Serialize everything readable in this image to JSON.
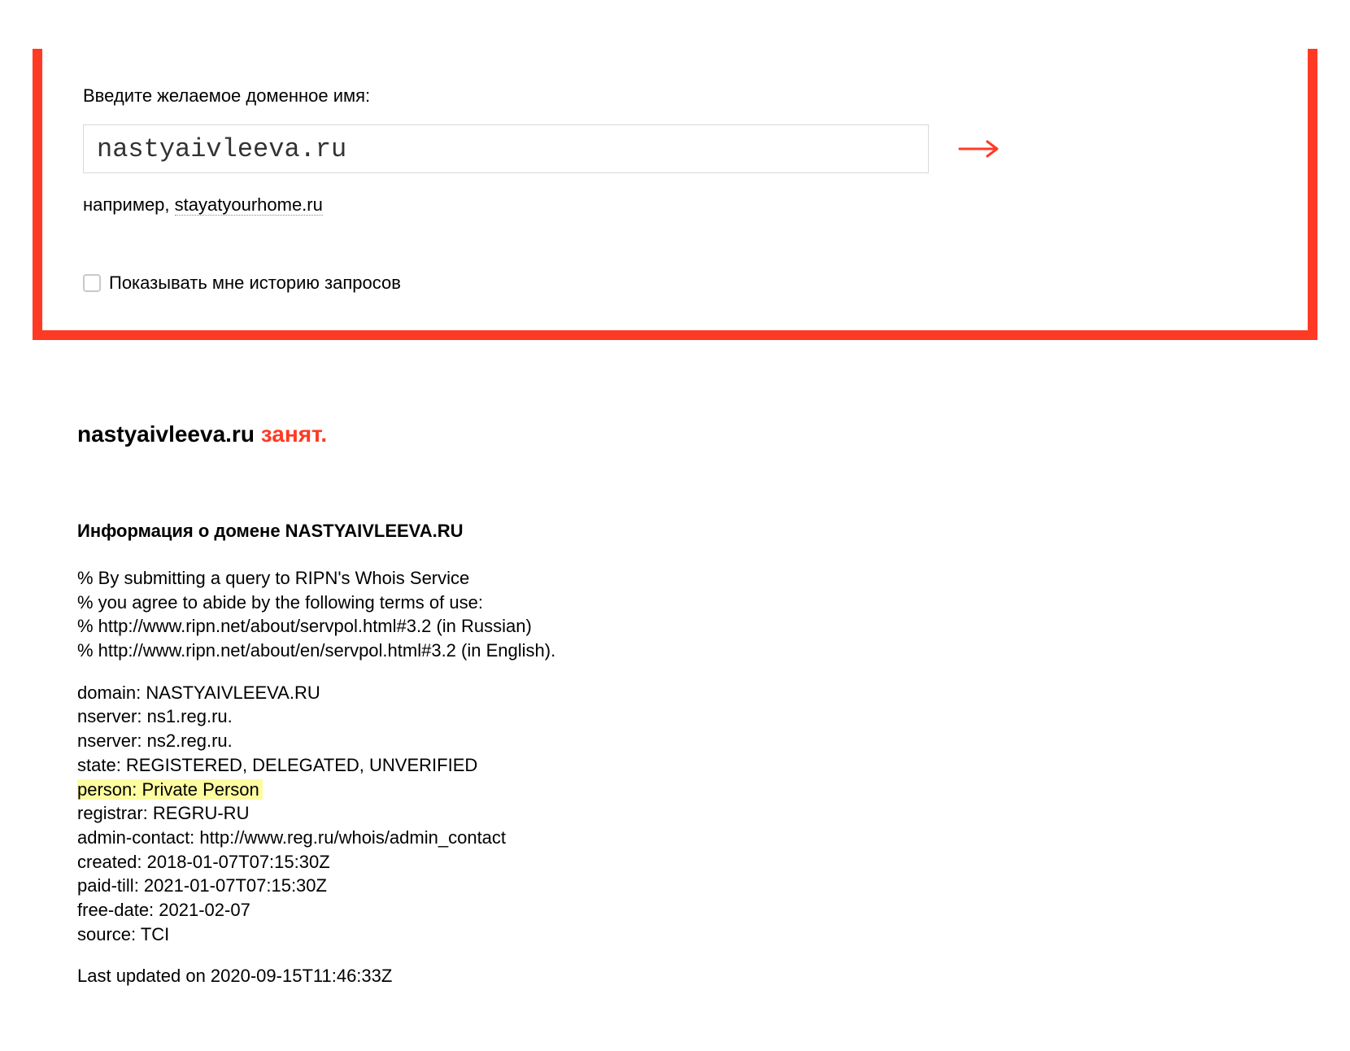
{
  "search": {
    "prompt": "Введите желаемое доменное имя:",
    "value": "nastyaivleeva.ru",
    "example_prefix": "например, ",
    "example_domain": "stayatyourhome.ru",
    "history_label": "Показывать мне историю запросов"
  },
  "result": {
    "domain": "nastyaivleeva.ru",
    "status_word": "занят."
  },
  "info": {
    "heading": "Информация о домене NASTYAIVLEEVA.RU",
    "preamble": [
      "% By submitting a query to RIPN's Whois Service",
      "% you agree to abide by the following terms of use:",
      "% http://www.ripn.net/about/servpol.html#3.2 (in Russian)",
      "% http://www.ripn.net/about/en/servpol.html#3.2 (in English)."
    ],
    "fields": {
      "domain": "domain: NASTYAIVLEEVA.RU",
      "ns1": "nserver: ns1.reg.ru.",
      "ns2": "nserver: ns2.reg.ru.",
      "state": "state: REGISTERED, DELEGATED, UNVERIFIED",
      "person": "person: Private Person",
      "registrar": "registrar: REGRU-RU",
      "admin_contact": "admin-contact: http://www.reg.ru/whois/admin_contact",
      "created": "created: 2018-01-07T07:15:30Z",
      "paid_till": "paid-till: 2021-01-07T07:15:30Z",
      "free_date": "free-date: 2021-02-07",
      "source": "source: TCI"
    },
    "last_updated": "Last updated on 2020-09-15T11:46:33Z"
  }
}
